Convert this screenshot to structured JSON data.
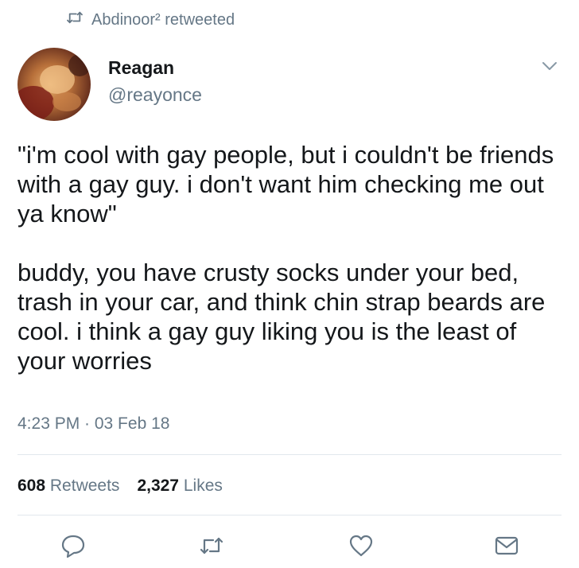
{
  "retweet": {
    "text": "Abdinoor² retweeted"
  },
  "author": {
    "name": "Reagan",
    "handle": "@reayonce"
  },
  "tweet": {
    "paragraphs": [
      "\"i'm cool with gay people, but i couldn't be friends with a gay guy. i don't want him checking me out ya know\"",
      "buddy, you have crusty socks under your bed, trash in your car, and think chin strap beards are cool. i think a gay guy liking you is the least of your worries"
    ],
    "timestamp": "4:23 PM · 03 Feb 18"
  },
  "stats": {
    "retweets_count": "608",
    "retweets_label": "Retweets",
    "likes_count": "2,327",
    "likes_label": "Likes"
  },
  "icons": [
    "retweet-icon",
    "chevron-down-icon",
    "reply-icon",
    "retweet-icon",
    "like-icon",
    "message-icon"
  ],
  "colors": {
    "text": "#14171a",
    "secondary": "#657786",
    "divider": "#e1e8ed"
  }
}
